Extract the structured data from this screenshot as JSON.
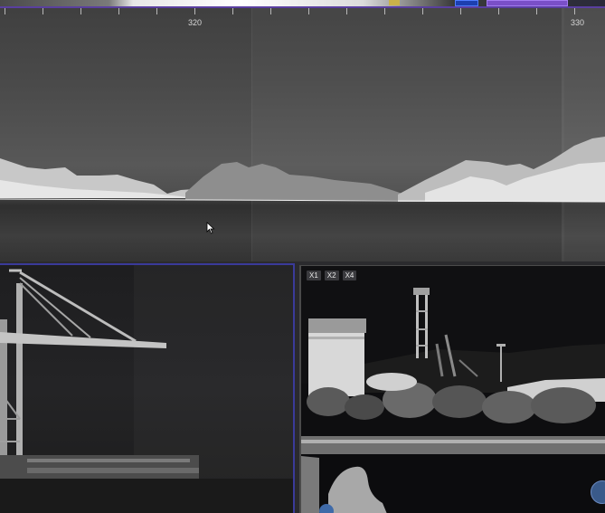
{
  "ruler": {
    "labels": [
      "320",
      "330"
    ]
  },
  "zoom_buttons": [
    "X1",
    "X2",
    "X4"
  ],
  "colors": {
    "accent_blue": "#1c3fb0",
    "accent_purple": "#7a4fc8",
    "panel_border": "#3a3a9a"
  },
  "icons": [
    "pointer-cursor-icon",
    "floating-action-icon"
  ]
}
